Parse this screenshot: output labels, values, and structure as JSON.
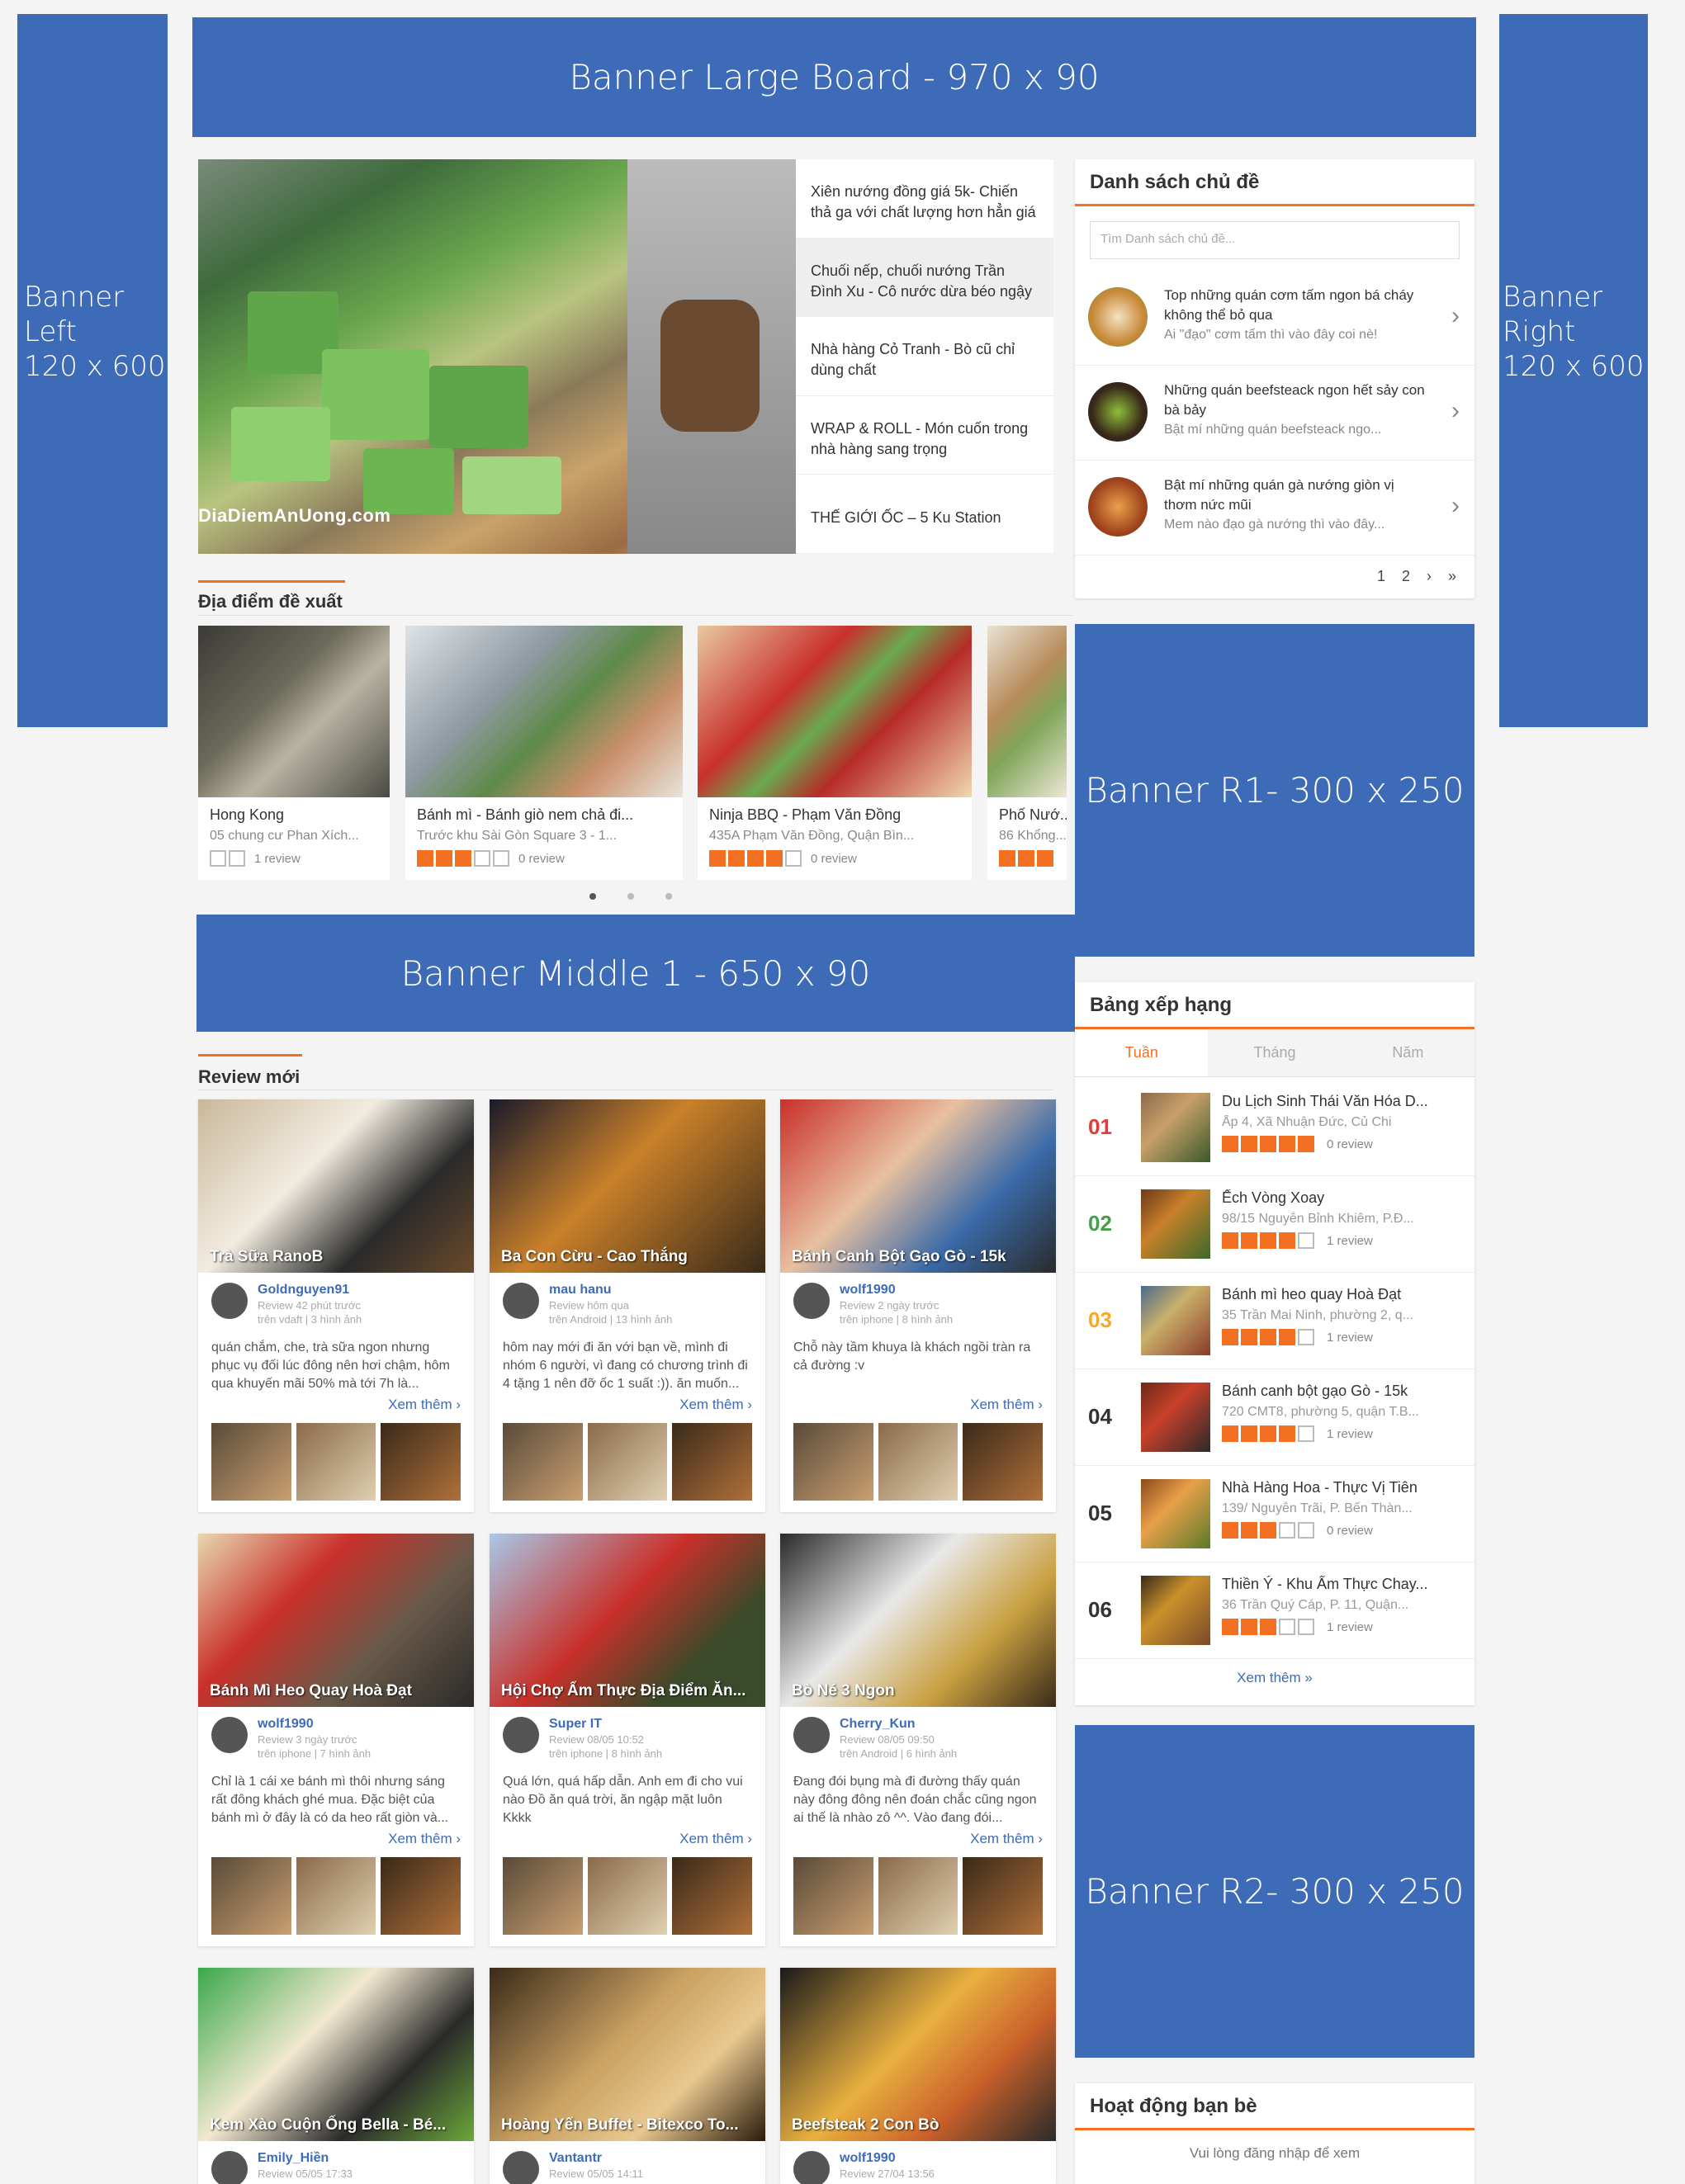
{
  "banners": {
    "large": "Banner Large Board - 970 x 90",
    "left": "Banner Left\n120 x 600",
    "right": "Banner Right\n120 x 600",
    "r1": "Banner R1- 300 x 250",
    "middle": "Banner Middle 1 - 650 x 90",
    "r2": "Banner R2- 300 x 250"
  },
  "featured": {
    "watermark": "DiaDiemAnUong.com",
    "items": [
      "Xiên nướng đồng giá 5k- Chiến thả ga với chất lượng hơn hẳn giá",
      "Chuối nếp, chuối nướng Trần Đình Xu - Cô nước dừa béo ngậy",
      "Nhà hàng Cỏ Tranh - Bò cũ chỉ dùng chất",
      "WRAP & ROLL - Món cuốn trong nhà hàng sang trọng",
      "THẾ GIỚI ỐC – 5 Ku Station"
    ]
  },
  "suggest": {
    "title": "Địa điểm đề xuất",
    "places": [
      {
        "name": "Hong Kong",
        "addr": "05 chung cư Phan Xích...",
        "rating": 0,
        "reviews": "1 review"
      },
      {
        "name": "Bánh mì - Bánh giò nem chả đi...",
        "addr": "Trước khu Sài Gòn Square 3 - 1...",
        "rating": 3,
        "reviews": "0 review"
      },
      {
        "name": "Ninja BBQ - Phạm Văn Đồng",
        "addr": "435A Phạm Văn Đồng, Quận Bìn...",
        "rating": 4,
        "reviews": "0 review"
      },
      {
        "name": "Phố Nướ...",
        "addr": "86 Khổng...",
        "rating": 3,
        "reviews": ""
      }
    ]
  },
  "topics": {
    "title": "Danh sách chủ đề",
    "placeholder": "Tìm Danh sách chủ đề...",
    "items": [
      {
        "title": "Top những quán cơm tấm ngon bá cháy không thể bỏ qua",
        "desc": "Ai \"đạo\" cơm tấm thì vào đây coi nè!"
      },
      {
        "title": "Những quán beefsteack ngon hết sảy con bà bảy",
        "desc": "Bật mí những quán beefsteack ngo..."
      },
      {
        "title": "Bật mí những quán gà nướng giòn vị thơm nức mũi",
        "desc": "Mem nào đạo gà nướng thì vào đây..."
      }
    ],
    "pages": [
      "1",
      "2",
      "›",
      "»"
    ]
  },
  "ranking": {
    "title": "Bảng xếp hạng",
    "tabs": [
      "Tuần",
      "Tháng",
      "Năm"
    ],
    "items": [
      {
        "num": "01",
        "color": "#e53935",
        "name": "Du Lịch Sinh Thái Văn Hóa D...",
        "addr": "Ấp 4, Xã Nhuận Đức, Củ Chi",
        "rating": 5,
        "reviews": "0 review"
      },
      {
        "num": "02",
        "color": "#43a047",
        "name": "Ếch Vòng Xoay",
        "addr": "98/15 Nguyễn Bỉnh Khiêm, P.Đ...",
        "rating": 4,
        "reviews": "1 review"
      },
      {
        "num": "03",
        "color": "#f9a825",
        "name": "Bánh mì heo quay Hoà Đạt",
        "addr": "35 Trần Mai Ninh, phường 2, q...",
        "rating": 4,
        "reviews": "1 review"
      },
      {
        "num": "04",
        "color": "#333333",
        "name": "Bánh canh bột gạo Gò - 15k",
        "addr": "720 CMT8, phường 5, quận T.B...",
        "rating": 4,
        "reviews": "1 review"
      },
      {
        "num": "05",
        "color": "#333333",
        "name": "Nhà Hàng Hoa - Thực Vị Tiên",
        "addr": "139/ Nguyễn Trãi, P. Bến Thàn...",
        "rating": 3,
        "reviews": "0 review"
      },
      {
        "num": "06",
        "color": "#333333",
        "name": "Thiền Ý - Khu Ẩm Thực Chay...",
        "addr": "36 Trần Quý Cáp, P. 11, Quận...",
        "rating": 3,
        "reviews": "1 review"
      }
    ],
    "more": "Xem thêm »"
  },
  "reviews": {
    "title": "Review mới",
    "more": "Xem thêm ›",
    "items": [
      {
        "title": "Trà Sữa RanoB",
        "user": "Goldnguyen91",
        "meta": "Review 42 phút trước\ntrên vdaft | 3 hình ảnh",
        "text": "quán chắm, che, trà sữa ngon nhưng phục vụ đối lúc đông nên hơi chậm, hôm qua khuyến mãi 50% mà tới 7h là..."
      },
      {
        "title": "Ba Con Cừu - Cao Thắng",
        "user": "mau hanu",
        "meta": "Review hôm qua\ntrên Android | 13 hình ảnh",
        "text": "hôm nay mới đi ăn với bạn về, mình đi nhóm 6 người, vì đang có chương trình đi 4 tặng 1 nên đỡ ốc 1 suất :)). ăn muốn..."
      },
      {
        "title": "Bánh Canh Bột Gạo Gò - 15k",
        "user": "wolf1990",
        "meta": "Review 2 ngày trước\ntrên iphone | 8 hình ảnh",
        "text": "Chỗ này tầm khuya là khách ngồi tràn ra cả đường :v"
      },
      {
        "title": "Bánh Mì Heo Quay Hoà Đạt",
        "user": "wolf1990",
        "meta": "Review 3 ngày trước\ntrên iphone | 7 hình ảnh",
        "text": "Chỉ là 1 cái xe bánh mì thôi nhưng sáng rất đông khách ghé mua. Đặc biệt của bánh mì ở đây là có da heo rất giòn và..."
      },
      {
        "title": "Hội Chợ Ẩm Thực Địa Điểm Ăn...",
        "user": "Super IT",
        "meta": "Review 08/05 10:52\ntrên iphone | 8 hình ảnh",
        "text": "Quá lớn, quá hấp dẫn. Anh em đi cho vui nào Đồ ăn quá trời, ăn ngập mặt luôn Kkkk"
      },
      {
        "title": "Bò Né 3 Ngon",
        "user": "Cherry_Kun",
        "meta": "Review 08/05 09:50\ntrên Android | 6 hình ảnh",
        "text": "Đang đói bụng mà đi đường thấy quán này đông đông nên đoán chắc cũng ngon ai thế là nhào zô ^^. Vào đang đói..."
      },
      {
        "title": "Kem Xào Cuộn Ống Bella - Bé...",
        "user": "Emily_Hiền",
        "meta": "Review 05/05 17:33",
        "text": ""
      },
      {
        "title": "Hoàng Yến Buffet - Bitexco To...",
        "user": "Vantantr",
        "meta": "Review 05/05 14:11",
        "text": ""
      },
      {
        "title": "Beefsteak 2 Con Bò",
        "user": "wolf1990",
        "meta": "Review 27/04 13:56",
        "text": ""
      }
    ]
  },
  "friends": {
    "title": "Hoạt động bạn bè",
    "message": "Vui lòng đăng nhập để xem"
  },
  "colors": {
    "banner": "#3d6bb8",
    "accent": "#f36f21"
  }
}
